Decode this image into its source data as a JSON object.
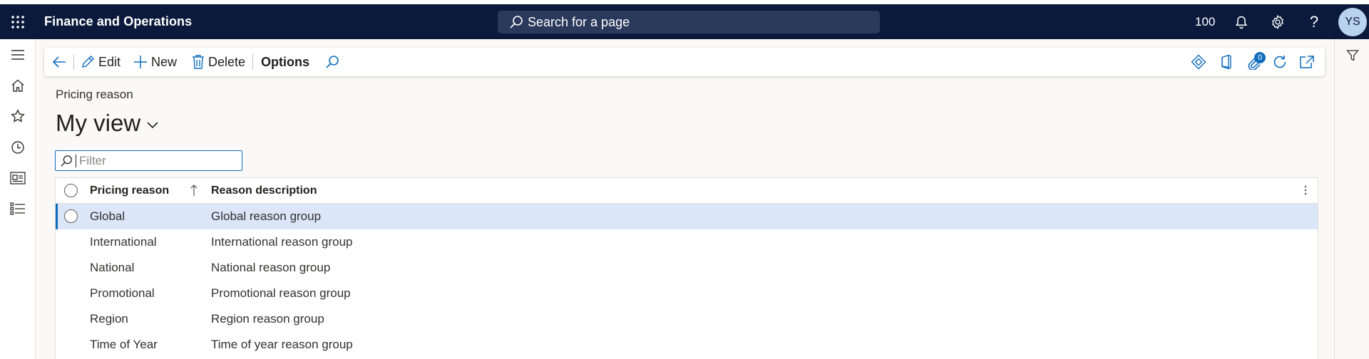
{
  "app": {
    "title": "Finance and Operations"
  },
  "topbar": {
    "search_placeholder": "Search for a page",
    "company": "100",
    "user_initials": "YS",
    "icons": [
      "waffle-icon",
      "bell-icon",
      "gear-icon",
      "help-icon"
    ]
  },
  "leftnav": {
    "icons": [
      "hamburger-icon",
      "home-icon",
      "star-icon",
      "clock-icon",
      "workspace-icon",
      "list-icon"
    ]
  },
  "actionbar": {
    "edit": "Edit",
    "new": "New",
    "delete": "Delete",
    "options": "Options",
    "attachments_count": "0"
  },
  "page": {
    "caption": "Pricing reason",
    "view_name": "My view",
    "filter_placeholder": "Filter"
  },
  "grid": {
    "columns": [
      "Pricing reason",
      "Reason description"
    ],
    "rows": [
      {
        "reason": "Global",
        "description": "Global reason group",
        "selected": true
      },
      {
        "reason": "International",
        "description": "International reason group"
      },
      {
        "reason": "National",
        "description": "National reason group"
      },
      {
        "reason": "Promotional",
        "description": "Promotional reason group"
      },
      {
        "reason": "Region",
        "description": "Region reason group"
      },
      {
        "reason": "Time of Year",
        "description": "Time of year reason group"
      }
    ]
  },
  "colors": {
    "topbar": "#0b1a3c",
    "accent": "#0f6cbd",
    "selected_row": "#dbe6f9"
  }
}
